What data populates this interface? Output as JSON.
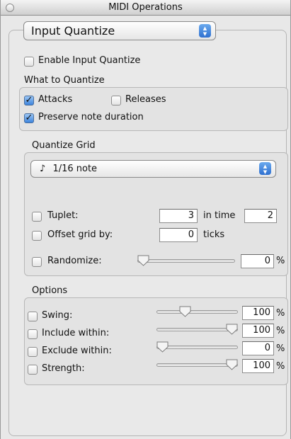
{
  "window": {
    "title": "MIDI Operations"
  },
  "mode_popup": {
    "value": "Input Quantize"
  },
  "enable": {
    "label": "Enable Input Quantize",
    "checked": false
  },
  "what_to_quantize": {
    "heading": "What to Quantize",
    "attacks": {
      "label": "Attacks",
      "checked": true
    },
    "releases": {
      "label": "Releases",
      "checked": false
    },
    "preserve": {
      "label": "Preserve note duration",
      "checked": true
    }
  },
  "quantize_grid": {
    "heading": "Quantize Grid",
    "grid_value": "1/16 note",
    "note_glyph": "♪",
    "tuplet": {
      "label": "Tuplet:",
      "value": "3",
      "in_time_label": "in time",
      "in_time_value": "2",
      "checked": false
    },
    "offset": {
      "label": "Offset grid by:",
      "value": "0",
      "unit": "ticks",
      "checked": false
    },
    "randomize": {
      "label": "Randomize:",
      "value": "0",
      "unit": "%",
      "level": 0,
      "checked": false
    }
  },
  "options": {
    "heading": "Options",
    "swing": {
      "label": "Swing:",
      "value": "100",
      "unit": "%",
      "level": 0.33,
      "checked": false
    },
    "include": {
      "label": "Include within:",
      "value": "100",
      "unit": "%",
      "level": 1.0,
      "checked": false
    },
    "exclude": {
      "label": "Exclude within:",
      "value": "0",
      "unit": "%",
      "level": 0.0,
      "checked": false
    },
    "strength": {
      "label": "Strength:",
      "value": "100",
      "unit": "%",
      "level": 1.0,
      "checked": false
    }
  },
  "colors": {
    "accent": "#2f70d0",
    "check_fill": "#3d84dc"
  }
}
